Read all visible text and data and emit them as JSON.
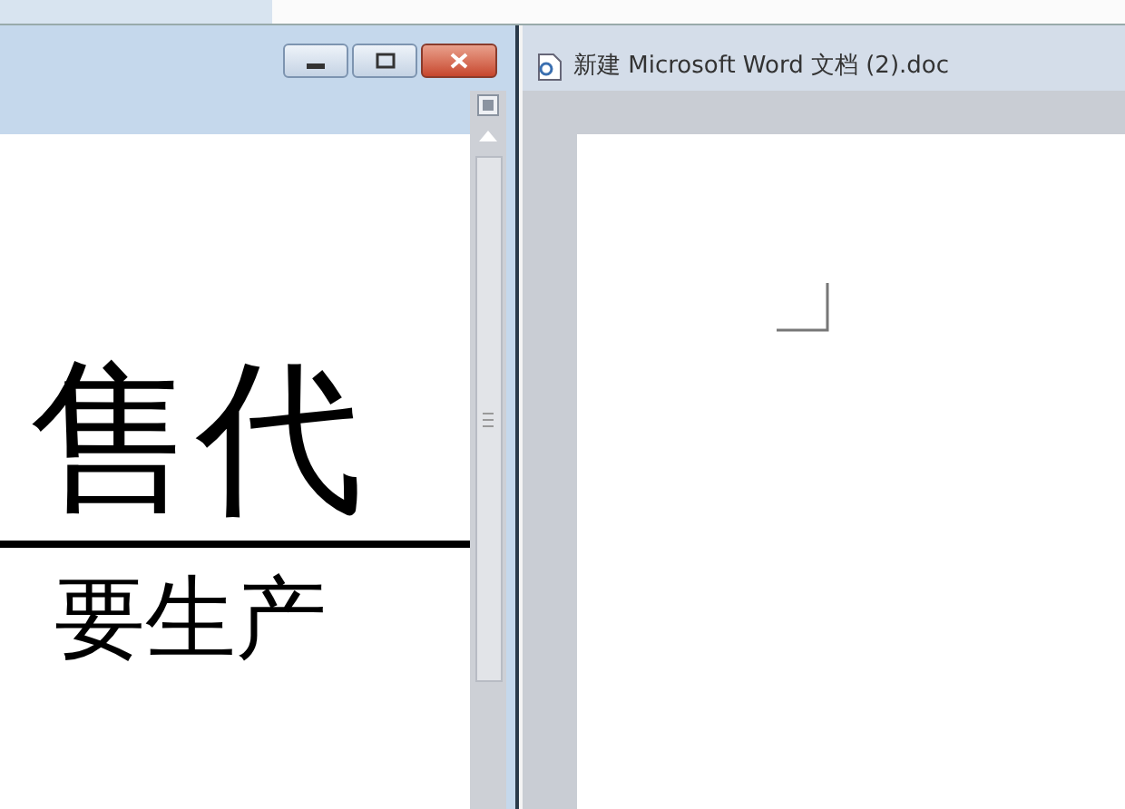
{
  "left_window": {
    "buttons": [
      {
        "kind": "minimize"
      },
      {
        "kind": "maximize"
      },
      {
        "kind": "close"
      }
    ],
    "document": {
      "heading": "售代",
      "body": "要生产"
    }
  },
  "right_window": {
    "title": "新建 Microsoft Word 文档 (2).doc"
  }
}
